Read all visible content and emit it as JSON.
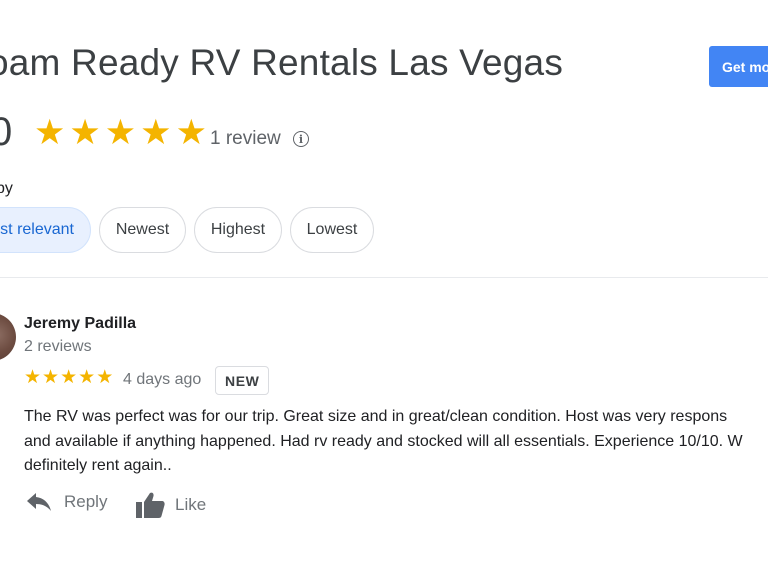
{
  "header": {
    "title": "oam Ready RV Rentals Las Vegas",
    "cta_label": "Get mo"
  },
  "summary": {
    "rating": "0",
    "stars": 5,
    "review_count": "1 review"
  },
  "sort": {
    "label": "by",
    "options": [
      "ost relevant",
      "Newest",
      "Highest",
      "Lowest"
    ],
    "active_index": 0
  },
  "review": {
    "author": "Jeremy Padilla",
    "author_meta": "2 reviews",
    "stars": 5,
    "date": "4 days ago",
    "badge": "NEW",
    "lines": [
      "The RV was perfect was for our trip. Great size and in great/clean condition.  Host was very respons",
      "and available if anything happened. Had rv ready and stocked will all essentials. Experience 10/10. W",
      "definitely rent again.."
    ],
    "actions": {
      "reply": "Reply",
      "like": "Like"
    }
  },
  "colors": {
    "star": "#f4b400",
    "cta_bg": "#4285f4",
    "chip_active_bg": "#e8f0fe",
    "chip_active_text": "#1967d2"
  },
  "icons": {
    "rating_star": "star-icon",
    "info": "info-icon",
    "reply": "reply-icon",
    "like": "thumbs-up-icon"
  }
}
